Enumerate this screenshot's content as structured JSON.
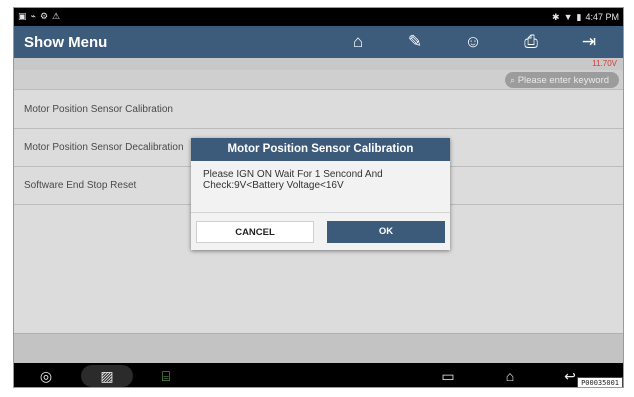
{
  "status_bar": {
    "left_icons": [
      "sim-icon",
      "signal-icon",
      "settings-icon",
      "warning-icon"
    ],
    "left_glyphs": [
      "▣",
      "⌁",
      "⚙",
      "⚠"
    ],
    "right_glyphs": [
      "✱",
      "▼",
      "▮"
    ],
    "time": "4:47 PM"
  },
  "header": {
    "title": "Show Menu",
    "buttons": [
      {
        "name": "home",
        "glyph": "⌂"
      },
      {
        "name": "edit",
        "glyph": "✎"
      },
      {
        "name": "user",
        "glyph": "☺"
      },
      {
        "name": "print",
        "glyph": "⎙"
      },
      {
        "name": "exit",
        "glyph": "⇥"
      }
    ]
  },
  "voltage": "11.70V",
  "search": {
    "placeholder": "Please enter keyword",
    "glyph": "⌕"
  },
  "menu_items": [
    "Motor Position Sensor Calibration",
    "Motor Position Sensor Decalibration",
    "Software End Stop Reset"
  ],
  "dialog": {
    "title": "Motor Position Sensor Calibration",
    "message_line1": "Please IGN ON Wait For 1 Sencond And",
    "message_line2": "Check:9V<Battery Voltage<16V",
    "cancel_label": "CANCEL",
    "ok_label": "OK"
  },
  "nav_bar": {
    "chrome_glyph": "◎",
    "gallery_glyph": "▨",
    "vci_glyph": "⌸",
    "recent_glyph": "▭",
    "home_glyph": "⌂",
    "back_glyph": "↩"
  },
  "reference_code": "P00035001"
}
